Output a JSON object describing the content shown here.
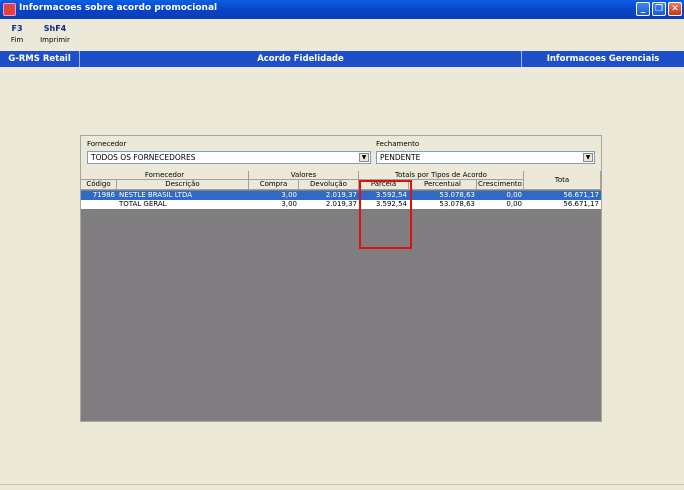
{
  "window": {
    "title": "Informacoes sobre acordo promocional",
    "minimize": "_",
    "restore": "❐",
    "close": "✕"
  },
  "toolbar": [
    {
      "key": "F3",
      "label": "Fim"
    },
    {
      "key": "ShF4",
      "label": "Imprimir"
    }
  ],
  "navbar": {
    "left": "G-RMS Retail",
    "center": "Acordo Fidelidade",
    "right": "Informacoes Gerenciais"
  },
  "filters": {
    "fornecedor_label": "Fornecedor",
    "fornecedor_value": "TODOS OS FORNECEDORES",
    "fechamento_label": "Fechamento",
    "fechamento_value": "PENDENTE"
  },
  "table": {
    "group_headers": {
      "fornecedor": "Fornecedor",
      "valores": "Valores",
      "totais": "Totais por Tipos de Acordo",
      "total": "Tota"
    },
    "columns": {
      "codigo": "Código",
      "descricao": "Descrição",
      "compra": "Compra",
      "devolucao": "Devolução",
      "parcela": "Parcela",
      "percentual": "Percentual",
      "crescimento": "Crescimento"
    },
    "rows": [
      {
        "codigo": "71986",
        "descricao": "NESTLE BRASIL LTDA",
        "compra": "3,00",
        "devolucao": "2.019,37",
        "parcela": "3.592,54",
        "percentual": "53.078,63",
        "crescimento": "0,00",
        "total": "56.671,17"
      },
      {
        "codigo": "",
        "descricao": "TOTAL GERAL",
        "compra": "3,00",
        "devolucao": "2.019,37",
        "parcela": "3.592,54",
        "percentual": "53.078,63",
        "crescimento": "0,00",
        "total": "56.671,17"
      }
    ]
  },
  "colors": {
    "selected_row": "#316ac5",
    "grid_empty": "#807d80",
    "highlight": "#e01010"
  }
}
